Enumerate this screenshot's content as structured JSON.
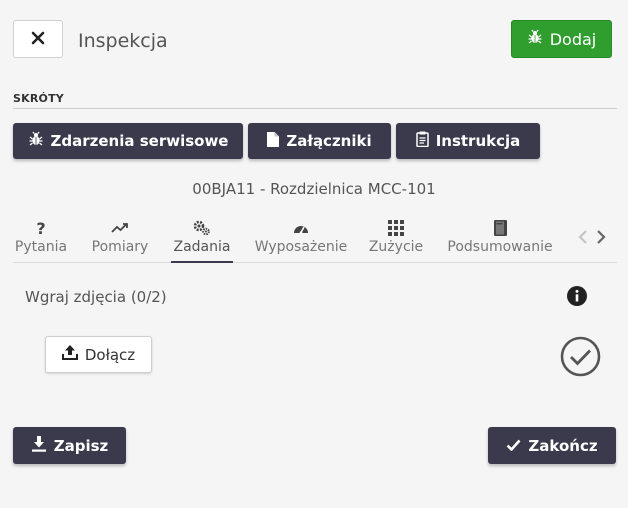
{
  "header": {
    "title": "Inspekcja",
    "add_label": "Dodaj"
  },
  "shortcuts": {
    "label": "SKRÓTY",
    "buttons": [
      {
        "label": "Zdarzenia serwisowe",
        "icon": "bug-icon"
      },
      {
        "label": "Załączniki",
        "icon": "file-icon"
      },
      {
        "label": "Instrukcja",
        "icon": "clipboard-icon"
      }
    ]
  },
  "device": "00BJA11 - Rozdzielnica MCC-101",
  "tabs": [
    {
      "label": "Pytania",
      "icon": "question-icon"
    },
    {
      "label": "Pomiary",
      "icon": "trend-icon"
    },
    {
      "label": "Zadania",
      "icon": "gears-icon",
      "active": true
    },
    {
      "label": "Wyposażenie",
      "icon": "gauge-icon"
    },
    {
      "label": "Zużycie",
      "icon": "grid-icon"
    },
    {
      "label": "Podsumowanie",
      "icon": "book-icon"
    }
  ],
  "task": {
    "label": "Wgraj zdjęcia (0/2)",
    "attach_label": "Dołącz"
  },
  "footer": {
    "save_label": "Zapisz",
    "finish_label": "Zakończ"
  },
  "colors": {
    "accent_green": "#2f9e2f",
    "dark_button": "#3a3a4c",
    "background": "#f5f5f5"
  }
}
